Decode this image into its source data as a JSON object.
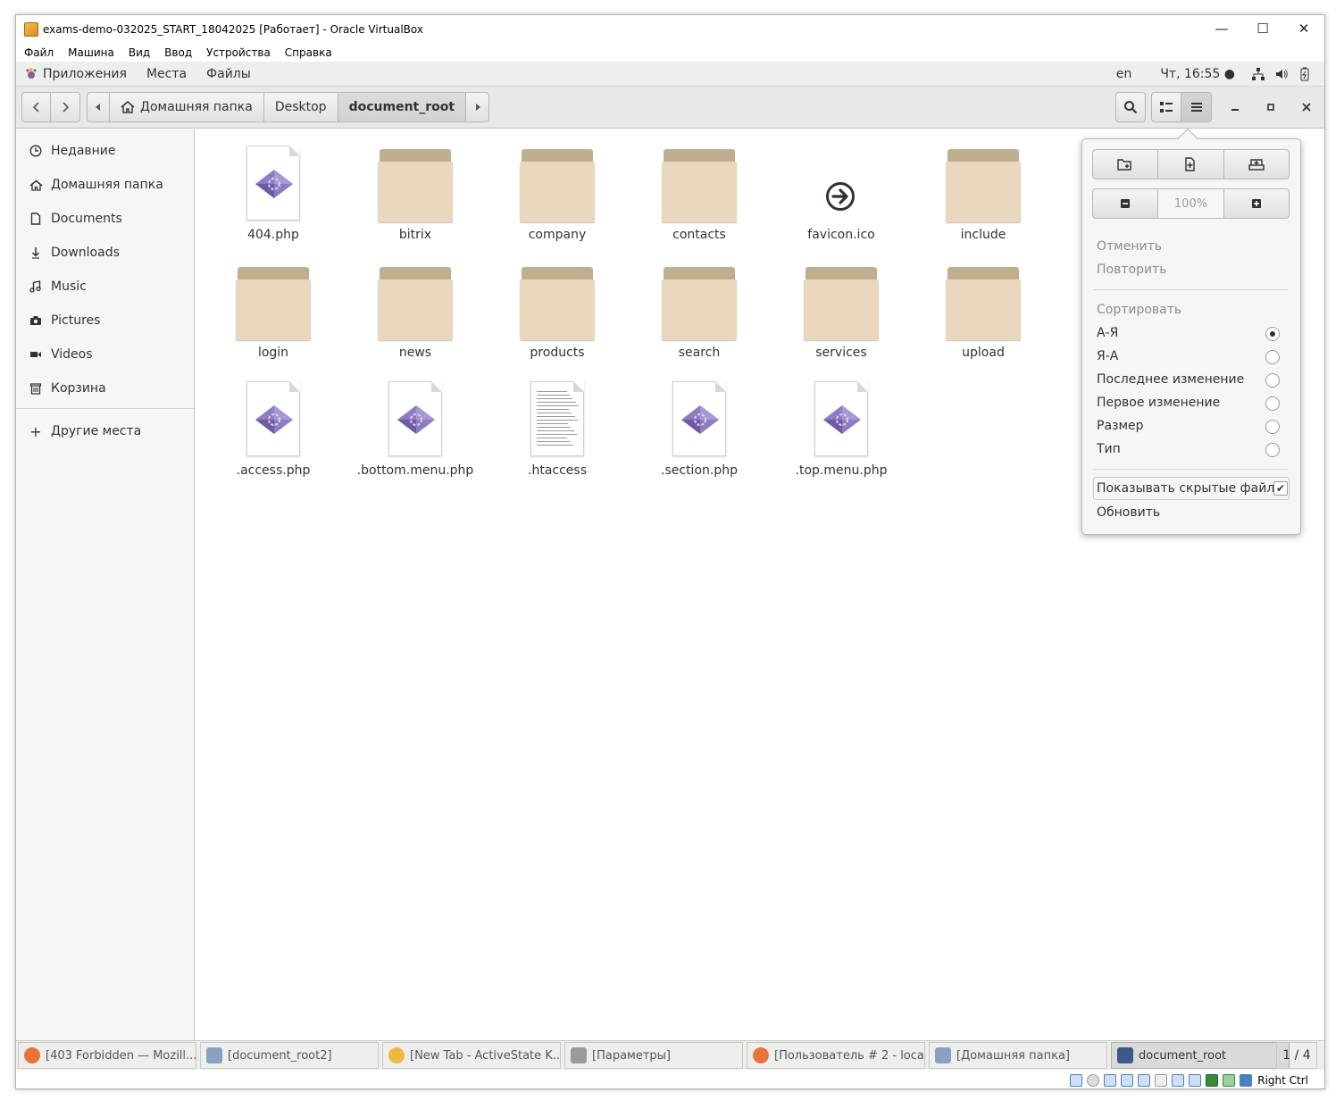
{
  "window": {
    "title": "exams-demo-032025_START_18042025 [Работает] - Oracle VirtualBox",
    "controls": {
      "minimize": "—",
      "maximize": "☐",
      "close": "✕"
    }
  },
  "vbox_menu": [
    "Файл",
    "Машина",
    "Вид",
    "Ввод",
    "Устройства",
    "Справка"
  ],
  "gnome_panel": {
    "apps": "Приложения",
    "places": "Места",
    "files": "Файлы",
    "lang": "en",
    "clock": "Чт, 16:55 ●"
  },
  "breadcrumb": [
    "Домашняя папка",
    "Desktop",
    "document_root"
  ],
  "sidebar": {
    "items": [
      {
        "label": "Недавние",
        "icon": "clock-icon"
      },
      {
        "label": "Домашняя папка",
        "icon": "home-icon"
      },
      {
        "label": "Documents",
        "icon": "document-icon"
      },
      {
        "label": "Downloads",
        "icon": "download-icon"
      },
      {
        "label": "Music",
        "icon": "music-icon"
      },
      {
        "label": "Pictures",
        "icon": "camera-icon"
      },
      {
        "label": "Videos",
        "icon": "video-icon"
      },
      {
        "label": "Корзина",
        "icon": "trash-icon"
      }
    ],
    "other": "Другие места"
  },
  "files": [
    {
      "name": "404.php",
      "type": "php"
    },
    {
      "name": "bitrix",
      "type": "folder"
    },
    {
      "name": "company",
      "type": "folder"
    },
    {
      "name": "contacts",
      "type": "folder"
    },
    {
      "name": "favicon.ico",
      "type": "ico"
    },
    {
      "name": "include",
      "type": "folder"
    },
    {
      "name": "login",
      "type": "folder"
    },
    {
      "name": "news",
      "type": "folder"
    },
    {
      "name": "products",
      "type": "folder"
    },
    {
      "name": "search",
      "type": "folder"
    },
    {
      "name": "services",
      "type": "folder"
    },
    {
      "name": "upload",
      "type": "folder"
    },
    {
      "name": ".access.php",
      "type": "php"
    },
    {
      "name": ".bottom.menu.php",
      "type": "php"
    },
    {
      "name": ".htaccess",
      "type": "text"
    },
    {
      "name": ".section.php",
      "type": "php"
    },
    {
      "name": ".top.menu.php",
      "type": "php"
    }
  ],
  "popover": {
    "zoom": "100%",
    "undo": "Отменить",
    "redo": "Повторить",
    "sort_header": "Сортировать",
    "sort_options": [
      "А-Я",
      "Я-А",
      "Последнее изменение",
      "Первое изменение",
      "Размер",
      "Тип"
    ],
    "sort_selected": "А-Я",
    "show_hidden": "Показывать скрытые файлы",
    "show_hidden_checked": true,
    "refresh": "Обновить"
  },
  "taskbar": {
    "tasks": [
      {
        "label": "[403 Forbidden — Mozill...",
        "icon": "firefox-icon",
        "color": "#e8743b"
      },
      {
        "label": "[document_root2]",
        "icon": "files-icon",
        "color": "#8aa0c0"
      },
      {
        "label": "[New Tab - ActiveState K...",
        "icon": "komodo-icon",
        "color": "#f0b840"
      },
      {
        "label": "[Параметры]",
        "icon": "settings-icon",
        "color": "#9a9a9a"
      },
      {
        "label": "[Пользователь # 2 - loca...",
        "icon": "firefox-icon",
        "color": "#e8743b"
      },
      {
        "label": "[Домашняя папка]",
        "icon": "files-icon",
        "color": "#8aa0c0"
      },
      {
        "label": "document_root",
        "icon": "files-icon",
        "color": "#3a5a8c"
      }
    ],
    "active_index": 6,
    "pager": "1 / 4"
  },
  "statusbar": {
    "hostkey": "Right Ctrl"
  }
}
